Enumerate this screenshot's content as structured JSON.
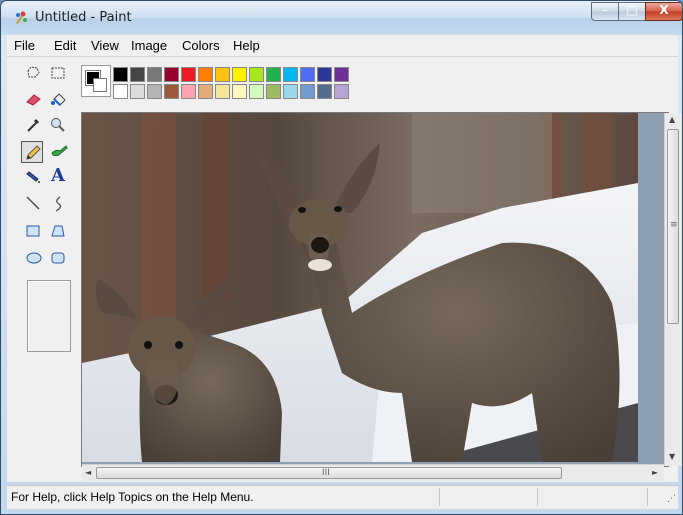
{
  "window": {
    "title": "Untitled - Paint"
  },
  "caption_buttons": {
    "minimize": "–",
    "maximize": "□",
    "close": "X"
  },
  "menu": [
    "File",
    "Edit",
    "View",
    "Image",
    "Colors",
    "Help"
  ],
  "tools": [
    {
      "name": "free-form-select",
      "icon": "lasso-icon"
    },
    {
      "name": "select",
      "icon": "dashed-rect-icon"
    },
    {
      "name": "eraser",
      "icon": "eraser-icon"
    },
    {
      "name": "fill-with-color",
      "icon": "paint-bucket-icon"
    },
    {
      "name": "pick-color",
      "icon": "eyedropper-icon"
    },
    {
      "name": "magnifier",
      "icon": "magnifier-icon"
    },
    {
      "name": "pencil",
      "icon": "pencil-icon",
      "selected": true
    },
    {
      "name": "brush",
      "icon": "brush-icon"
    },
    {
      "name": "airbrush",
      "icon": "airbrush-icon"
    },
    {
      "name": "text",
      "icon": "text-icon",
      "glyph": "A"
    },
    {
      "name": "line",
      "icon": "line-icon"
    },
    {
      "name": "curve",
      "icon": "curve-icon"
    },
    {
      "name": "rectangle",
      "icon": "rectangle-icon"
    },
    {
      "name": "polygon",
      "icon": "polygon-icon"
    },
    {
      "name": "ellipse",
      "icon": "ellipse-icon"
    },
    {
      "name": "rounded-rectangle",
      "icon": "rounded-rect-icon"
    }
  ],
  "colors": {
    "foreground": "#000000",
    "background": "#ffffff",
    "palette_top": [
      "#000000",
      "#464646",
      "#787878",
      "#990030",
      "#ed1c24",
      "#ff7e00",
      "#ffc20e",
      "#fff200",
      "#a8e61d",
      "#22b14c",
      "#00b7ef",
      "#4d6df3",
      "#2f3699",
      "#6f3198"
    ],
    "palette_bottom": [
      "#ffffff",
      "#dcdcdc",
      "#b4b4b4",
      "#9c5a3c",
      "#ffa3b1",
      "#e5aa7a",
      "#f5e49c",
      "#fff9bd",
      "#d3f9bc",
      "#9dbb61",
      "#99d9ea",
      "#709ad1",
      "#546d8e",
      "#b5a5d5"
    ]
  },
  "scrollbars": {
    "up": "▲",
    "down": "▼",
    "left": "◄",
    "right": "►",
    "v_grip": "≡",
    "h_grip": "III"
  },
  "status": {
    "help_text": "For Help, click Help Topics on the Help Menu."
  }
}
